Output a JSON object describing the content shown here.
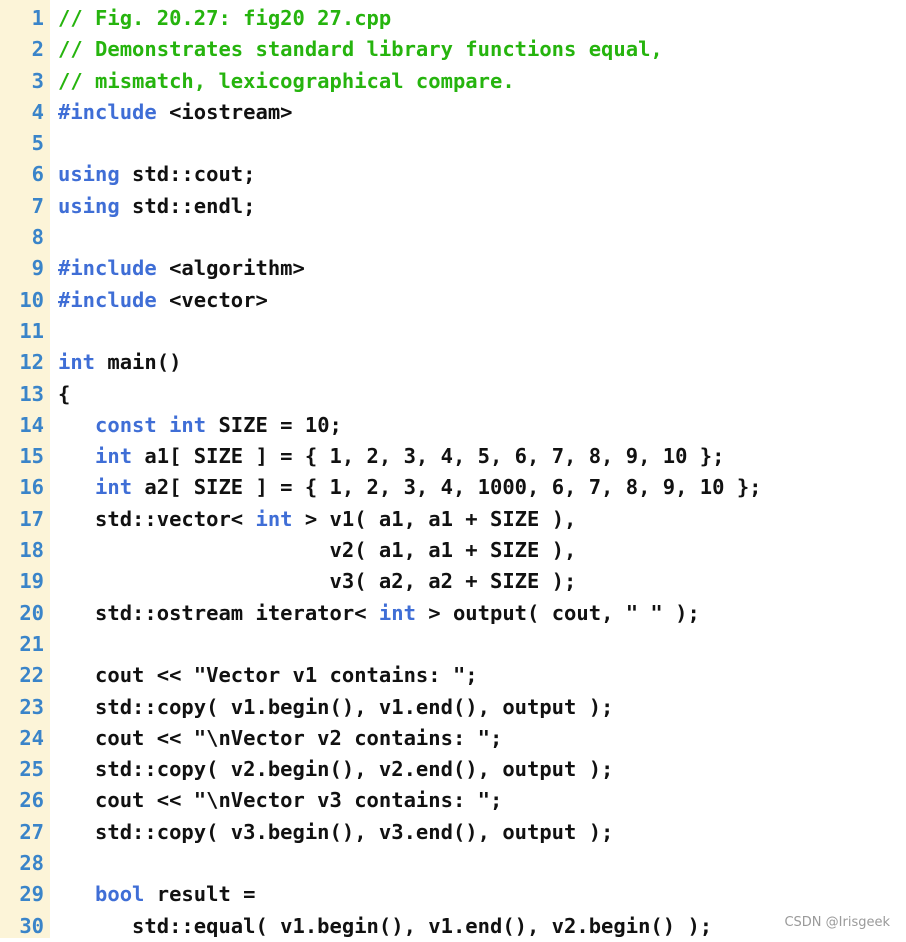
{
  "colors": {
    "gutter_background": "#fcf4d8",
    "line_number": "#3a84c9",
    "comment": "#26b40e",
    "keyword": "#3f6ed6",
    "text": "#111111"
  },
  "code": {
    "lines": [
      {
        "n": "1",
        "tokens": [
          {
            "t": "// Fig. 20.27: fig20 27.cpp",
            "c": "comment"
          }
        ]
      },
      {
        "n": "2",
        "tokens": [
          {
            "t": "// Demonstrates standard library functions equal,",
            "c": "comment"
          }
        ]
      },
      {
        "n": "3",
        "tokens": [
          {
            "t": "// mismatch, lexicographical compare.",
            "c": "comment"
          }
        ]
      },
      {
        "n": "4",
        "tokens": [
          {
            "t": "#include",
            "c": "kw"
          },
          {
            "t": " <iostream>",
            "c": "plain"
          }
        ]
      },
      {
        "n": "5",
        "tokens": []
      },
      {
        "n": "6",
        "tokens": [
          {
            "t": "using",
            "c": "kw"
          },
          {
            "t": " std::cout;",
            "c": "plain"
          }
        ]
      },
      {
        "n": "7",
        "tokens": [
          {
            "t": "using",
            "c": "kw"
          },
          {
            "t": " std::endl;",
            "c": "plain"
          }
        ]
      },
      {
        "n": "8",
        "tokens": []
      },
      {
        "n": "9",
        "tokens": [
          {
            "t": "#include",
            "c": "kw"
          },
          {
            "t": " <algorithm>",
            "c": "plain"
          }
        ]
      },
      {
        "n": "10",
        "tokens": [
          {
            "t": "#include",
            "c": "kw"
          },
          {
            "t": " <vector>",
            "c": "plain"
          }
        ]
      },
      {
        "n": "11",
        "tokens": []
      },
      {
        "n": "12",
        "tokens": [
          {
            "t": "int",
            "c": "kw"
          },
          {
            "t": " main()",
            "c": "plain"
          }
        ]
      },
      {
        "n": "13",
        "tokens": [
          {
            "t": "{",
            "c": "plain"
          }
        ]
      },
      {
        "n": "14",
        "tokens": [
          {
            "t": "   ",
            "c": "plain"
          },
          {
            "t": "const",
            "c": "kw"
          },
          {
            "t": " ",
            "c": "plain"
          },
          {
            "t": "int",
            "c": "kw"
          },
          {
            "t": " SIZE = 10;",
            "c": "plain"
          }
        ]
      },
      {
        "n": "15",
        "tokens": [
          {
            "t": "   ",
            "c": "plain"
          },
          {
            "t": "int",
            "c": "kw"
          },
          {
            "t": " a1[ SIZE ] = { 1, 2, 3, 4, 5, 6, 7, 8, 9, 10 };",
            "c": "plain"
          }
        ]
      },
      {
        "n": "16",
        "tokens": [
          {
            "t": "   ",
            "c": "plain"
          },
          {
            "t": "int",
            "c": "kw"
          },
          {
            "t": " a2[ SIZE ] = { 1, 2, 3, 4, 1000, 6, 7, 8, 9, 10 };",
            "c": "plain"
          }
        ]
      },
      {
        "n": "17",
        "tokens": [
          {
            "t": "   std::vector< ",
            "c": "plain"
          },
          {
            "t": "int",
            "c": "kw"
          },
          {
            "t": " > v1( a1, a1 + SIZE ),",
            "c": "plain"
          }
        ]
      },
      {
        "n": "18",
        "tokens": [
          {
            "t": "                      v2( a1, a1 + SIZE ),",
            "c": "plain"
          }
        ]
      },
      {
        "n": "19",
        "tokens": [
          {
            "t": "                      v3( a2, a2 + SIZE );",
            "c": "plain"
          }
        ]
      },
      {
        "n": "20",
        "tokens": [
          {
            "t": "   std::ostream iterator< ",
            "c": "plain"
          },
          {
            "t": "int",
            "c": "kw"
          },
          {
            "t": " > output( cout, \" \" );",
            "c": "plain"
          }
        ]
      },
      {
        "n": "21",
        "tokens": []
      },
      {
        "n": "22",
        "tokens": [
          {
            "t": "   cout << \"Vector v1 contains: \";",
            "c": "plain"
          }
        ]
      },
      {
        "n": "23",
        "tokens": [
          {
            "t": "   std::copy( v1.begin(), v1.end(), output );",
            "c": "plain"
          }
        ]
      },
      {
        "n": "24",
        "tokens": [
          {
            "t": "   cout << \"\\nVector v2 contains: \";",
            "c": "plain"
          }
        ]
      },
      {
        "n": "25",
        "tokens": [
          {
            "t": "   std::copy( v2.begin(), v2.end(), output );",
            "c": "plain"
          }
        ]
      },
      {
        "n": "26",
        "tokens": [
          {
            "t": "   cout << \"\\nVector v3 contains: \";",
            "c": "plain"
          }
        ]
      },
      {
        "n": "27",
        "tokens": [
          {
            "t": "   std::copy( v3.begin(), v3.end(), output );",
            "c": "plain"
          }
        ]
      },
      {
        "n": "28",
        "tokens": []
      },
      {
        "n": "29",
        "tokens": [
          {
            "t": "   ",
            "c": "plain"
          },
          {
            "t": "bool",
            "c": "kw"
          },
          {
            "t": " result =",
            "c": "plain"
          }
        ]
      },
      {
        "n": "30",
        "tokens": [
          {
            "t": "      std::equal( v1.begin(), v1.end(), v2.begin() );",
            "c": "plain"
          }
        ]
      }
    ]
  },
  "watermark": "CSDN @Irisgeek"
}
